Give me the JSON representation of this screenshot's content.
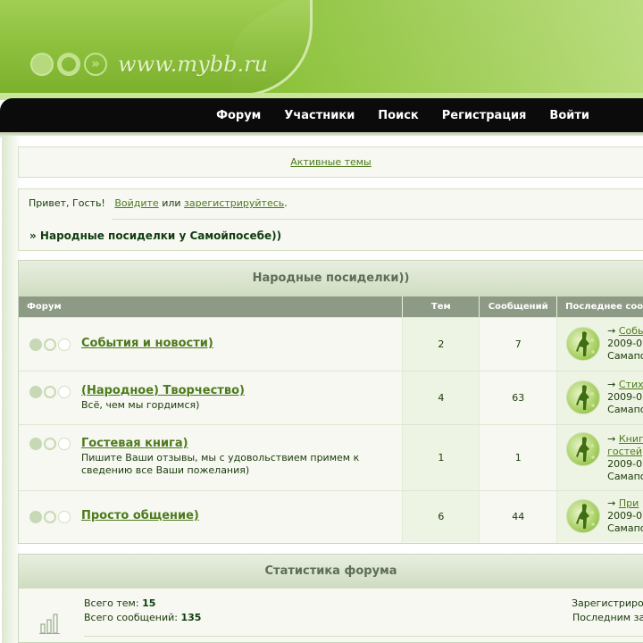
{
  "header": {
    "logo_text": "www.mybb.ru"
  },
  "nav": {
    "items": [
      "Форум",
      "Участники",
      "Поиск",
      "Регистрация",
      "Войти"
    ]
  },
  "active_topics": "Активные темы",
  "welcome": {
    "hello": "Привет, Гость!",
    "login": "Войдите",
    "or": "или",
    "register": "зарегистрируйтесь",
    "dot": ".",
    "crumb": "» Народные посиделки у Самойпосебе))"
  },
  "category": {
    "title": "Народные посиделки))",
    "columns": [
      "Форум",
      "Тем",
      "Сообщений",
      "Последнее сообщение"
    ],
    "forums": [
      {
        "title": "События и новости)",
        "desc": "",
        "topics": "2",
        "posts": "7",
        "last": {
          "link": "Собы",
          "date": "2009-0",
          "author": "Самапо"
        }
      },
      {
        "title": "(Народное) Творчество)",
        "desc": "Всё, чем мы гордимся)",
        "topics": "4",
        "posts": "63",
        "last": {
          "link": "Стих",
          "date": "2009-0",
          "author": "Самапо"
        }
      },
      {
        "title": "Гостевая книга)",
        "desc": "Пишите Ваши отзывы, мы с удовольствием примем к сведению все Ваши пожелания)",
        "topics": "1",
        "posts": "1",
        "last": {
          "link": "Книг",
          "link2": "гостей",
          "date": "2009-0",
          "author": "Самапо"
        }
      },
      {
        "title": "Просто общение)",
        "desc": "",
        "topics": "6",
        "posts": "44",
        "last": {
          "link": "При",
          "date": "2009-0",
          "author": "Самапо"
        }
      }
    ]
  },
  "stats": {
    "title": "Статистика форума",
    "topics_label": "Всего тем:",
    "topics_value": "15",
    "posts_label": "Всего сообщений:",
    "posts_value": "135",
    "right1": "Зарегистриро",
    "right2": "Последним за"
  },
  "colors": {
    "accent": "#8cc23a",
    "link": "#4d7a1c",
    "nav_bg": "#0b0b0b"
  }
}
